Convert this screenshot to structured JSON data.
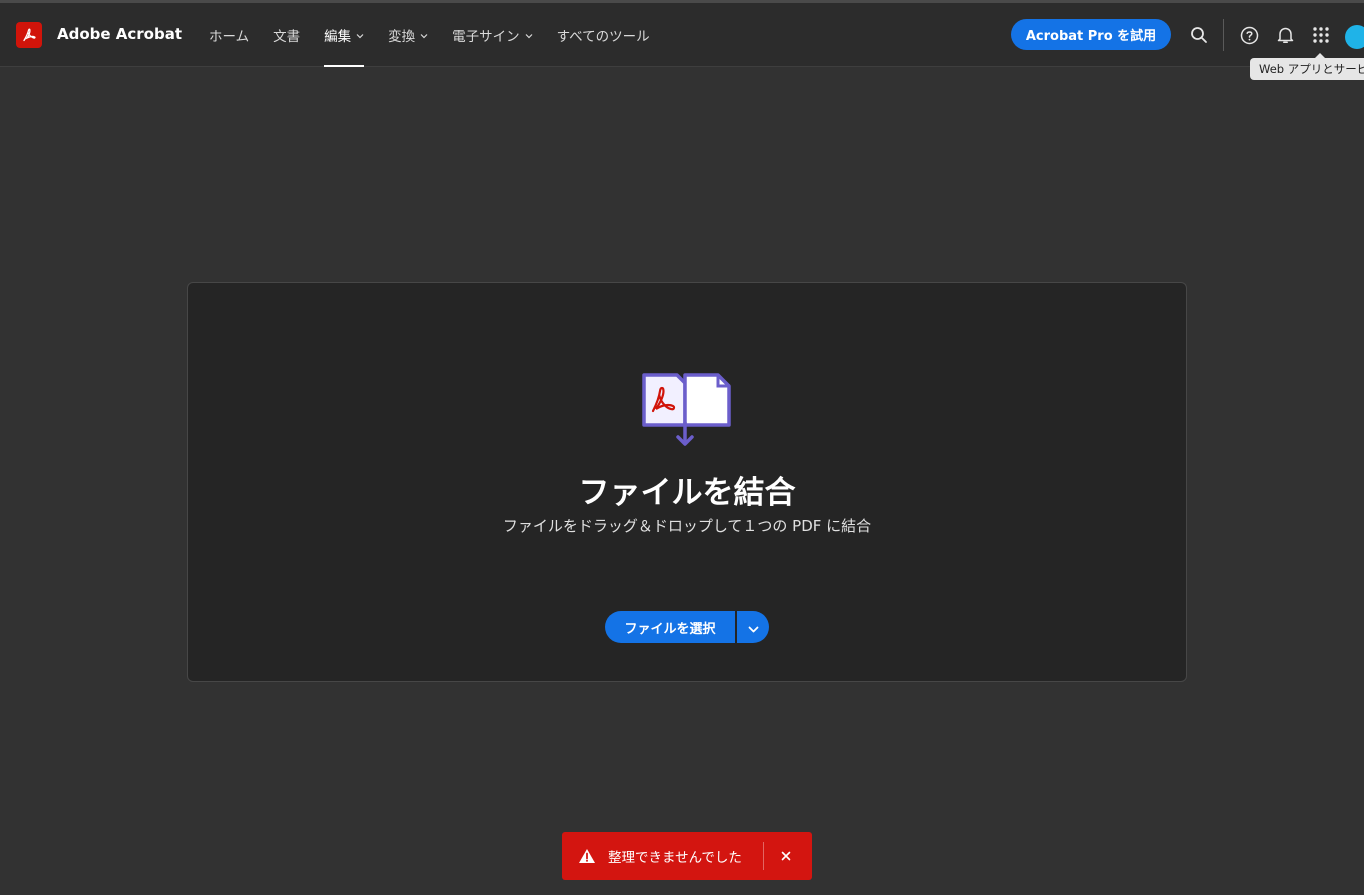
{
  "header": {
    "app_title": "Adobe Acrobat",
    "nav": [
      {
        "label": "ホーム",
        "has_menu": false
      },
      {
        "label": "文書",
        "has_menu": false
      },
      {
        "label": "編集",
        "has_menu": true,
        "active": true
      },
      {
        "label": "変換",
        "has_menu": true
      },
      {
        "label": "電子サイン",
        "has_menu": true
      },
      {
        "label": "すべてのツール",
        "has_menu": false
      }
    ],
    "trial_button": "Acrobat Pro を試用",
    "icons": [
      "search-icon",
      "help-icon",
      "bell-icon",
      "apps-grid-icon",
      "avatar"
    ],
    "tooltip": "Web アプリとサービス"
  },
  "dropzone": {
    "title": "ファイルを結合",
    "subtitle": "ファイルをドラッグ＆ドロップして１つの PDF に結合",
    "select_button": "ファイルを選択"
  },
  "toast": {
    "message": "整理できませんでした",
    "type": "error"
  },
  "colors": {
    "accent": "#1473e6",
    "error": "#d31510",
    "brand": "#d1140a",
    "background": "#323232"
  }
}
